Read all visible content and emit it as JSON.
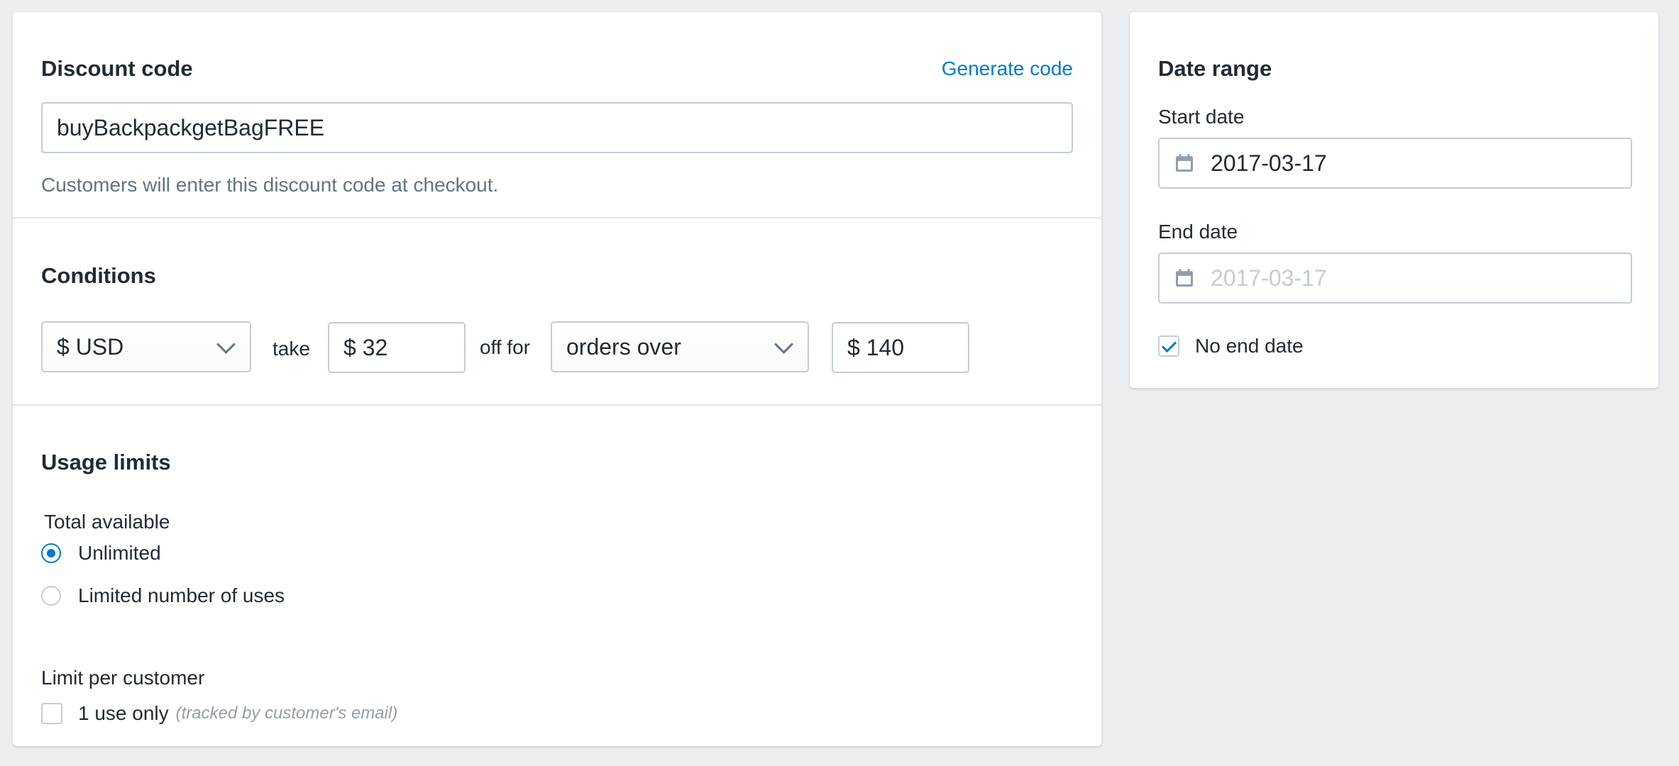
{
  "discount_code": {
    "heading": "Discount code",
    "generate_link": "Generate code",
    "code_value": "buyBackpackgetBagFREE",
    "help_text": "Customers will enter this discount code at checkout."
  },
  "conditions": {
    "heading": "Conditions",
    "currency": "$ USD",
    "take_word": "take",
    "amount": "$ 32",
    "off_for_word": "off for",
    "condition_type": "orders over",
    "threshold": "$ 140"
  },
  "usage_limits": {
    "heading": "Usage limits",
    "total_available_label": "Total available",
    "option_unlimited": "Unlimited",
    "option_limited": "Limited number of uses",
    "selected_option": "Unlimited",
    "limit_per_customer_label": "Limit per customer",
    "one_use_label": "1 use only",
    "one_use_note": "(tracked by customer's email)",
    "one_use_checked": false
  },
  "date_range": {
    "heading": "Date range",
    "start_label": "Start date",
    "start_value": "2017-03-17",
    "end_label": "End date",
    "end_placeholder": "2017-03-17",
    "no_end_date_label": "No end date",
    "no_end_date_checked": true
  },
  "icons": {
    "calendar": "calendar-icon",
    "chevron": "chevron-down-icon",
    "checkmark": "checkmark-icon"
  },
  "colors": {
    "accent": "#007ace",
    "background": "#ebeef0",
    "border": "#c4cdd5",
    "subdued_text": "#637381",
    "placeholder": "#c4cdd5"
  }
}
